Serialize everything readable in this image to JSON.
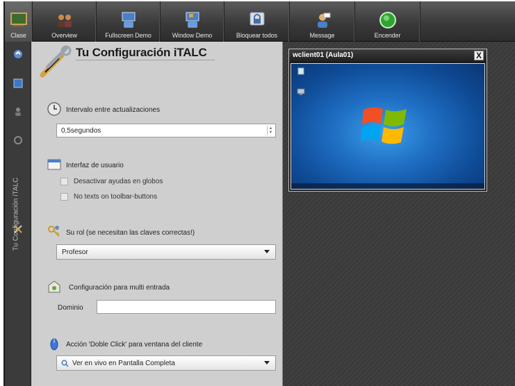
{
  "toolbar": {
    "buttons": [
      {
        "id": "clase",
        "label": "Clase"
      },
      {
        "id": "overview",
        "label": "Overview"
      },
      {
        "id": "fullscreen",
        "label": "Fullscreen Demo"
      },
      {
        "id": "window",
        "label": "Window Demo"
      },
      {
        "id": "lock",
        "label": "Bloquear todos"
      },
      {
        "id": "message",
        "label": "Message"
      },
      {
        "id": "power",
        "label": "Encender"
      }
    ]
  },
  "sidebar": {
    "tab_label": "Tu Configuración iTALC"
  },
  "config": {
    "title": "Tu Configuración iTALC",
    "update_interval": {
      "label": "Intervalo entre actualizaciones",
      "value": "0,5segundos"
    },
    "ui": {
      "label": "Interfaz de usuario",
      "options": [
        {
          "label": "Desactivar ayudas en globos",
          "checked": false
        },
        {
          "label": "No texts on toolbar-buttons",
          "checked": false
        }
      ]
    },
    "role": {
      "label": "Su rol (se necesitan las claves correctas!)",
      "value": "Profesor"
    },
    "multi_login": {
      "label": "Configuración para multi entrada",
      "domain_label": "Dominio",
      "domain_value": ""
    },
    "double_click": {
      "label": "Acción 'Doble Click' para ventana del cliente",
      "value": "Ver en vivo en Pantalla Completa"
    }
  },
  "client_window": {
    "title": "wclient01 (Aula01)",
    "close_label": "X"
  },
  "colors": {
    "toolbar_bg": "#3a3a3a",
    "panel_bg": "#cfcfcf",
    "desktop_blue": "#1f6fc4",
    "workspace_bg": "#3a3a3a"
  }
}
